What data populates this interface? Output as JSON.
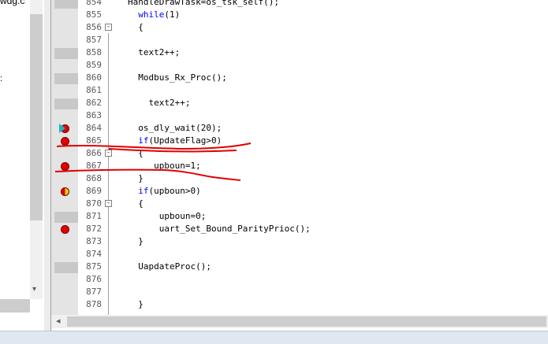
{
  "project_panel": {
    "file_fragment": "wdg.c",
    "tree_mark": ":"
  },
  "editor": {
    "lines": [
      {
        "num": "854",
        "code": "HandleDrawTask=os_tsk_self();",
        "marker": "shade",
        "fold": ""
      },
      {
        "num": "855",
        "code": "  while(1)",
        "marker": "",
        "fold": "",
        "keyword": "while"
      },
      {
        "num": "856",
        "code": "  {",
        "marker": "",
        "fold": "-"
      },
      {
        "num": "857",
        "code": "",
        "marker": "",
        "fold": ""
      },
      {
        "num": "858",
        "code": "  text2++;",
        "marker": "shade",
        "fold": ""
      },
      {
        "num": "859",
        "code": "",
        "marker": "",
        "fold": ""
      },
      {
        "num": "860",
        "code": "  Modbus_Rx_Proc();",
        "marker": "shade",
        "fold": ""
      },
      {
        "num": "861",
        "code": "",
        "marker": "",
        "fold": ""
      },
      {
        "num": "862",
        "code": "    text2++;",
        "marker": "shade",
        "fold": ""
      },
      {
        "num": "863",
        "code": "",
        "marker": "",
        "fold": ""
      },
      {
        "num": "864",
        "code": "  os_dly_wait(20);",
        "marker": "current-breakpoint",
        "fold": ""
      },
      {
        "num": "865",
        "code": "  if(UpdateFlag>0)",
        "marker": "breakpoint",
        "fold": "",
        "keyword": "if"
      },
      {
        "num": "866",
        "code": "  {",
        "marker": "",
        "fold": "-"
      },
      {
        "num": "867",
        "code": "     upboun=1;",
        "marker": "breakpoint",
        "fold": ""
      },
      {
        "num": "868",
        "code": "  }",
        "marker": "",
        "fold": ""
      },
      {
        "num": "869",
        "code": "  if(upboun>0)",
        "marker": "disabled-breakpoint",
        "fold": "",
        "keyword": "if"
      },
      {
        "num": "870",
        "code": "  {",
        "marker": "",
        "fold": "-"
      },
      {
        "num": "871",
        "code": "      upboun=0;",
        "marker": "shade",
        "fold": ""
      },
      {
        "num": "872",
        "code": "      uart_Set_Bound_ParityPrioc();",
        "marker": "breakpoint",
        "fold": ""
      },
      {
        "num": "873",
        "code": "  }",
        "marker": "",
        "fold": ""
      },
      {
        "num": "874",
        "code": "",
        "marker": "",
        "fold": ""
      },
      {
        "num": "875",
        "code": "  UapdateProc();",
        "marker": "shade",
        "fold": ""
      },
      {
        "num": "876",
        "code": "",
        "marker": "",
        "fold": ""
      },
      {
        "num": "877",
        "code": "",
        "marker": "",
        "fold": ""
      },
      {
        "num": "878",
        "code": "  }",
        "marker": "",
        "fold": ""
      }
    ]
  },
  "colors": {
    "keyword": "#0000ff",
    "breakpoint": "#e00000",
    "current_arrow": "#19b6c6",
    "annotation": "#e00000",
    "gutter": "#e4e4e4"
  },
  "icons": {
    "breakpoint": "breakpoint-icon",
    "current": "current-line-arrow-icon",
    "disabled": "disabled-breakpoint-icon",
    "fold": "fold-toggle-icon"
  }
}
